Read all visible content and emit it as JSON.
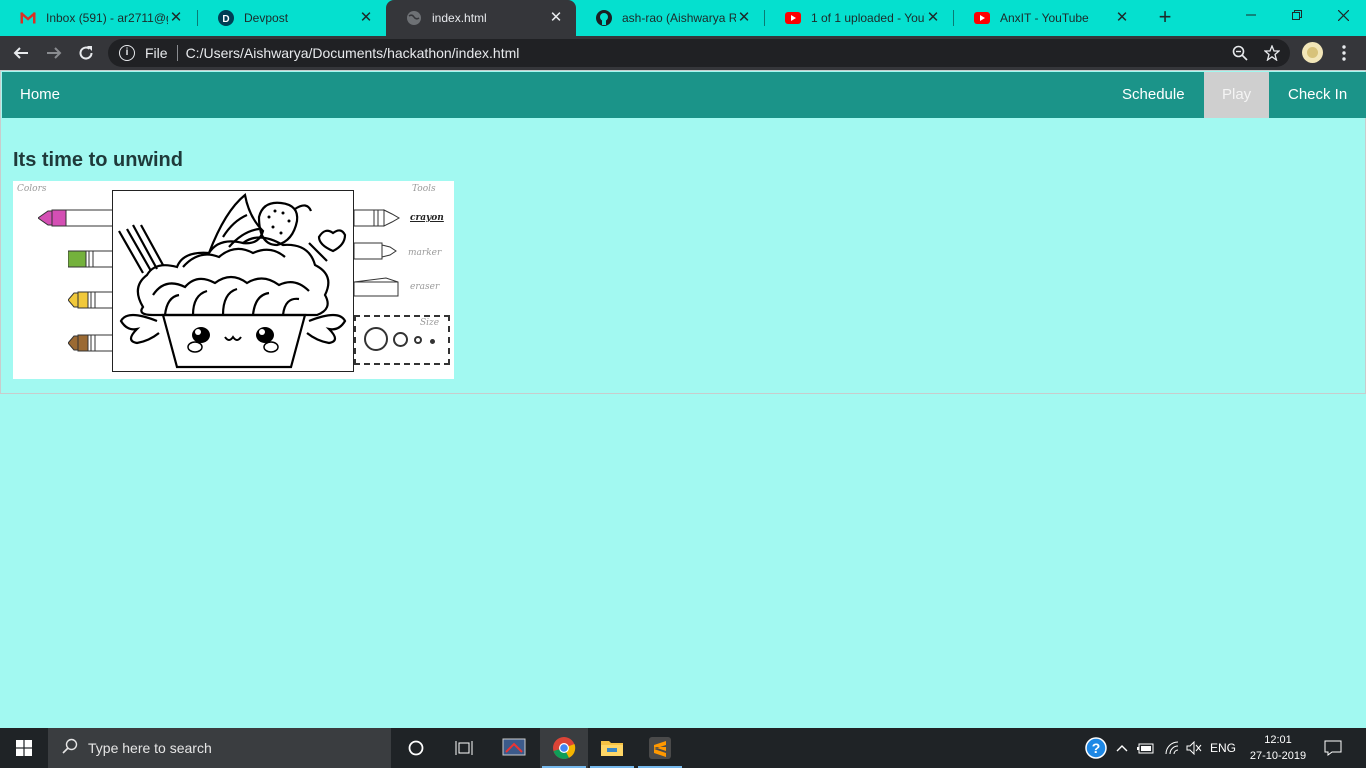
{
  "browser": {
    "tabs": [
      {
        "title": "Inbox (591) - ar2711@g",
        "favicon": "gmail-icon"
      },
      {
        "title": "Devpost",
        "favicon": "devpost-icon"
      },
      {
        "title": "index.html",
        "favicon": "globe-icon",
        "active": true
      },
      {
        "title": "ash-rao (Aishwarya Rao",
        "favicon": "github-icon"
      },
      {
        "title": "1 of 1 uploaded - YouTu",
        "favicon": "youtube-icon"
      },
      {
        "title": "AnxIT - YouTube",
        "favicon": "youtube-icon"
      }
    ],
    "address": {
      "scheme_label": "File",
      "url": "C:/Users/Aishwarya/Documents/hackathon/index.html"
    }
  },
  "page": {
    "nav": {
      "home": "Home",
      "schedule": "Schedule",
      "play": "Play",
      "checkin": "Check In"
    },
    "heading": "Its time to unwind",
    "board": {
      "colors_label": "Colors",
      "tools_label": "Tools",
      "tools": [
        "crayon",
        "marker",
        "eraser"
      ],
      "selected_tool": "crayon",
      "size_label": "Size",
      "crayon_colors": [
        "#d44fb4",
        "#74b13c",
        "#f1c93b",
        "#9b6a33"
      ]
    },
    "colors": {
      "navbar": "#1b9489",
      "background": "#a2f9f1",
      "active_tab": "#cfcfcf"
    }
  },
  "taskbar": {
    "search_placeholder": "Type here to search",
    "language": "ENG",
    "time": "12:01",
    "date": "27-10-2019"
  }
}
